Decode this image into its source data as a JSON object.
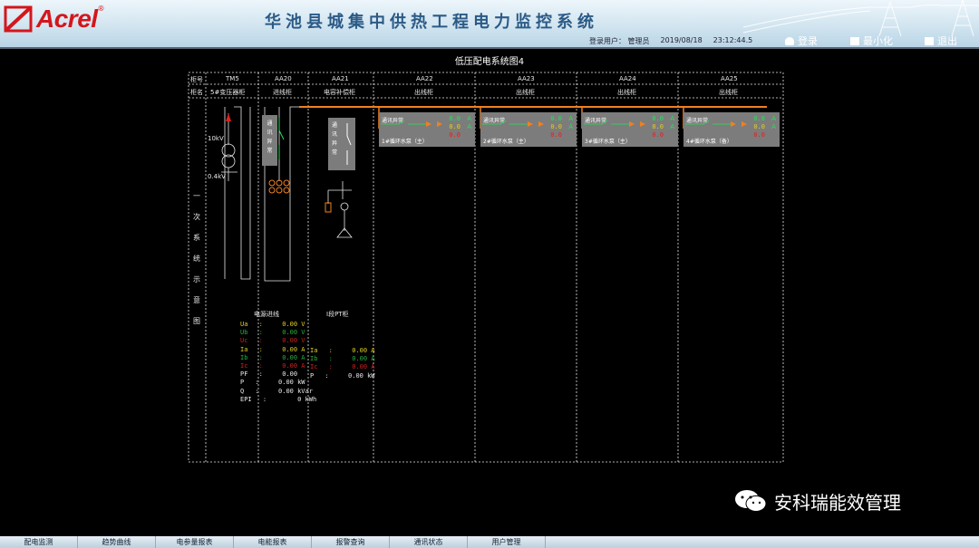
{
  "header": {
    "logo_text": "Acrel",
    "title": "华池县城集中供热工程电力监控系统",
    "user_label": "登录用户：",
    "user_name": "管理员",
    "date": "2019/08/18",
    "time": "23:12:44.5",
    "buttons": {
      "login": "登录",
      "minimize": "最小化",
      "exit": "退出"
    }
  },
  "diagram": {
    "title": "低压配电系统图4",
    "row_labels": {
      "cabinet_no": "柜号",
      "cabinet_name": "柜名"
    },
    "columns": [
      {
        "no": "TM5",
        "name": "5#变压器柜"
      },
      {
        "no": "AA20",
        "name": "进线柜"
      },
      {
        "no": "AA21",
        "name": "电容补偿柜"
      },
      {
        "no": "AA22",
        "name": "出线柜"
      },
      {
        "no": "AA23",
        "name": "出线柜"
      },
      {
        "no": "AA24",
        "name": "出线柜"
      },
      {
        "no": "AA25",
        "name": "出线柜"
      }
    ],
    "side_label": [
      "一",
      "次",
      "系",
      "统",
      "示",
      "意",
      "图"
    ],
    "transformer": {
      "hv": "10kV",
      "lv": "0.4kV"
    },
    "comm_box_text": [
      "通",
      "讯",
      "异",
      "常"
    ],
    "feeders": [
      {
        "status": "通讯异常",
        "name": "1#循环水泵（主）",
        "val1": "0.0",
        "val2": "0.0",
        "val3": "0.0",
        "unit": "A"
      },
      {
        "status": "通讯异常",
        "name": "2#循环水泵（主）",
        "val1": "0.0",
        "val2": "0.0",
        "val3": "0.0",
        "unit": "A"
      },
      {
        "status": "通讯异常",
        "name": "3#循环水泵（主）",
        "val1": "0.0",
        "val2": "0.0",
        "val3": "0.0",
        "unit": "A"
      },
      {
        "status": "通讯异常",
        "name": "4#循环水泵（备）",
        "val1": "0.0",
        "val2": "0.0",
        "val3": "0.0",
        "unit": "A"
      }
    ],
    "incoming_meter": {
      "title": "电源进线",
      "rows": [
        {
          "label": "Ua",
          "value": "0.00",
          "unit": "V",
          "color": "#e0d020"
        },
        {
          "label": "Ub",
          "value": "0.00",
          "unit": "V",
          "color": "#27b040"
        },
        {
          "label": "Uc",
          "value": "0.00",
          "unit": "V",
          "color": "#d02020"
        },
        {
          "label": "Ia",
          "value": "0.00",
          "unit": "A",
          "color": "#e0d020"
        },
        {
          "label": "Ib",
          "value": "0.00",
          "unit": "A",
          "color": "#27b040"
        },
        {
          "label": "Ic",
          "value": "0.00",
          "unit": "A",
          "color": "#d02020"
        },
        {
          "label": "PF",
          "value": "0.00",
          "unit": "",
          "color": "#e8e8e8"
        },
        {
          "label": "P",
          "value": "0.00",
          "unit": "kW",
          "color": "#e8e8e8"
        },
        {
          "label": "Q",
          "value": "0.00",
          "unit": "kVar",
          "color": "#e8e8e8"
        },
        {
          "label": "EPI",
          "value": "0",
          "unit": "kWh",
          "color": "#e8e8e8"
        }
      ]
    },
    "capacitor_meter": {
      "title": "I段PT柜",
      "rows": [
        {
          "label": "Ia",
          "value": "0.00",
          "unit": "A",
          "color": "#e0d020"
        },
        {
          "label": "Ib",
          "value": "0.00",
          "unit": "A",
          "color": "#27b040"
        },
        {
          "label": "Ic",
          "value": "0.00",
          "unit": "A",
          "color": "#d02020"
        },
        {
          "label": "P",
          "value": "0.00",
          "unit": "kW",
          "color": "#e8e8e8"
        }
      ]
    }
  },
  "footer_tabs": [
    "配电监测",
    "趋势曲线",
    "电参量报表",
    "电能报表",
    "报警查询",
    "通讯状态",
    "用户管理"
  ],
  "watermark": "安科瑞能效管理",
  "colors": {
    "busbar": "#f08020",
    "line": "#e8e8e8",
    "box": "#7c7c7c",
    "green": "#27e05a",
    "red": "#e02020",
    "yellow": "#e0d020"
  }
}
